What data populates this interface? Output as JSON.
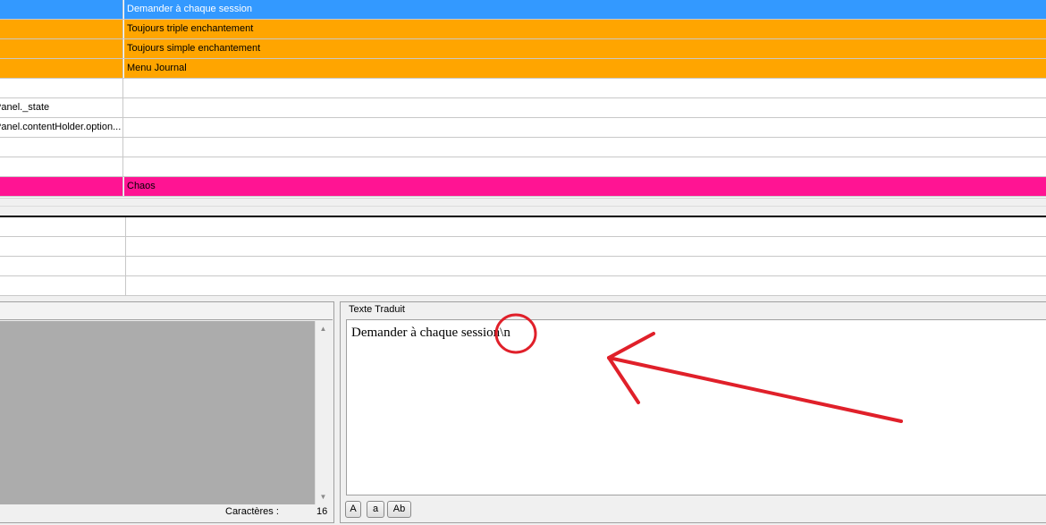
{
  "grid_top": {
    "rows": [
      {
        "key": "",
        "value": "Demander à chaque session",
        "bg": "#3399ff",
        "fg": "#ffffff"
      },
      {
        "key": "",
        "value": "Toujours triple enchantement",
        "bg": "#ffa500",
        "fg": "#000000"
      },
      {
        "key": "",
        "value": "Toujours simple enchantement",
        "bg": "#ffa500",
        "fg": "#000000"
      },
      {
        "key": "",
        "value": "Menu Journal",
        "bg": "#ffa500",
        "fg": "#000000"
      },
      {
        "key": "",
        "value": "",
        "bg": "#ffffff",
        "fg": "#000000"
      },
      {
        "key": "Panel._state",
        "value": "",
        "bg": "#ffffff",
        "fg": "#000000"
      },
      {
        "key": "Panel.contentHolder.option...",
        "value": "",
        "bg": "#ffffff",
        "fg": "#000000"
      },
      {
        "key": "",
        "value": "",
        "bg": "#ffffff",
        "fg": "#000000"
      },
      {
        "key": "",
        "value": "",
        "bg": "#ffffff",
        "fg": "#000000"
      },
      {
        "key": "",
        "value": "Chaos",
        "bg": "#ff1493",
        "fg": "#000000"
      }
    ]
  },
  "source_panel": {
    "char_label": "Caractères :",
    "char_count": "16"
  },
  "translated_panel": {
    "title": "Texte Traduit",
    "text": "Demander à chaque session\\n",
    "buttons": {
      "upper": "A",
      "lower": "a",
      "title_case": "Ab"
    }
  },
  "colors": {
    "annotation": "#e0202a"
  }
}
